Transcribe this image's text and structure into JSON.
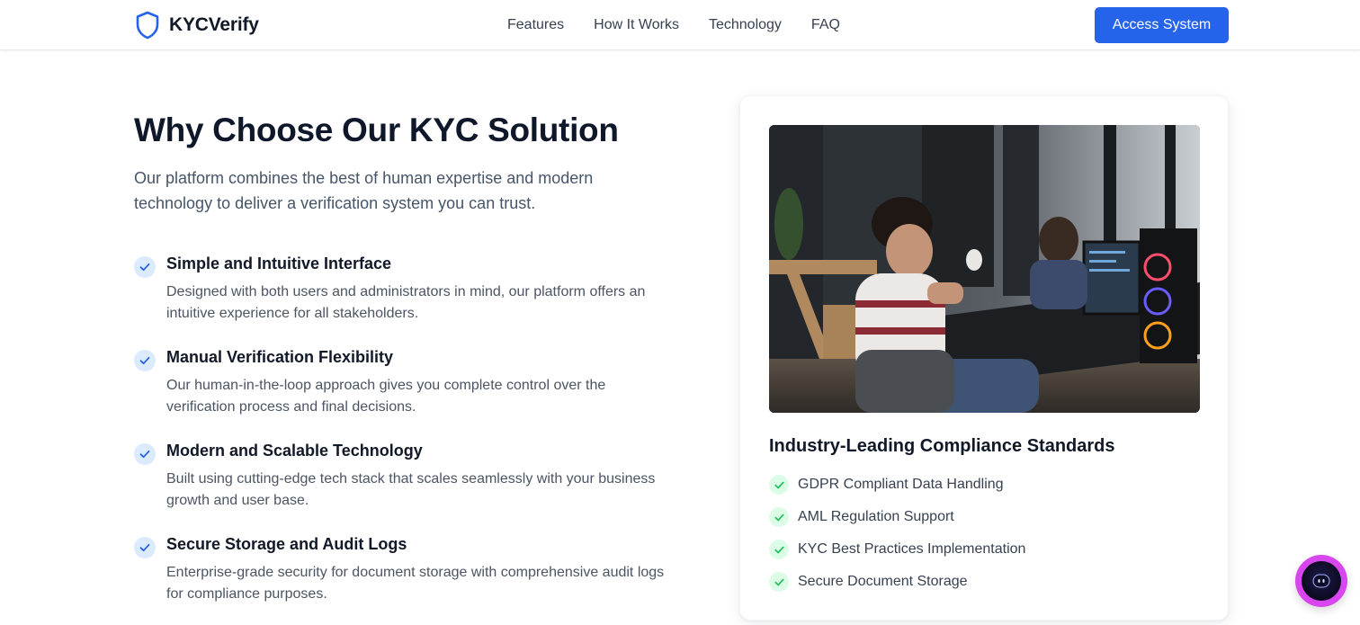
{
  "navbar": {
    "brand_name": "KYCVerify",
    "links": [
      "Features",
      "How It Works",
      "Technology",
      "FAQ"
    ],
    "cta_label": "Access System",
    "accent_color": "#2563eb"
  },
  "why": {
    "heading": "Why Choose Our KYC Solution",
    "intro": "Our platform combines the best of human expertise and modern technology to deliver a verification system you can trust.",
    "features": [
      {
        "title": "Simple and Intuitive Interface",
        "description": "Designed with both users and administrators in mind, our platform offers an intuitive experience for all stakeholders."
      },
      {
        "title": "Manual Verification Flexibility",
        "description": "Our human-in-the-loop approach gives you complete control over the verification process and final decisions."
      },
      {
        "title": "Modern and Scalable Technology",
        "description": "Built using cutting-edge tech stack that scales seamlessly with your business growth and user base."
      },
      {
        "title": "Secure Storage and Audit Logs",
        "description": "Enterprise-grade security for document storage with comprehensive audit logs for compliance purposes."
      }
    ]
  },
  "compliance": {
    "title": "Industry-Leading Compliance Standards",
    "items": [
      "GDPR Compliant Data Handling",
      "AML Regulation Support",
      "KYC Best Practices Implementation",
      "Secure Document Storage"
    ],
    "check_color": "#22c55e"
  },
  "icons": {
    "brand": "shield-icon",
    "feature_check": "check-icon",
    "compliance_check": "check-icon",
    "assistant": "chat-assistant-icon"
  }
}
